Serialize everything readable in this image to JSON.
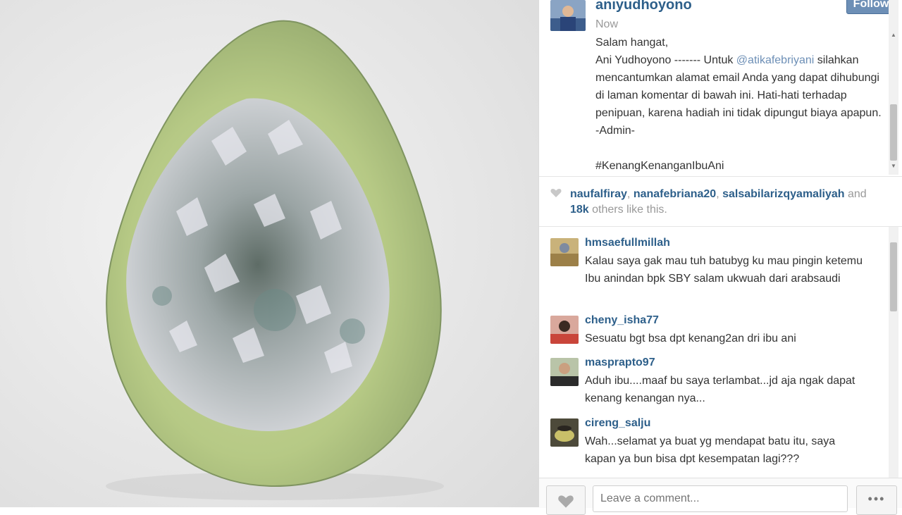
{
  "post": {
    "username": "aniyudhoyono",
    "follow_label": "Follow",
    "time": "Now",
    "caption_pre": "Salam hangat,\nAni Yudhoyono ------- Untuk ",
    "caption_mention": "@atikafebriyani",
    "caption_post": " silahkan mencantumkan alamat email Anda yang dapat dihubungi di laman komentar di bawah ini. Hati-hati terhadap penipuan, karena hadiah ini tidak dipungut biaya apapun. -Admin-\n\n#KenangKenanganIbuAni"
  },
  "likes": {
    "user1": "naufalfiray",
    "sep1": ", ",
    "user2": "nanafebriana20",
    "sep2": ", ",
    "user3": "salsabilarizqyamaliyah",
    "and": " and ",
    "count": "18k",
    "suffix": " others like this."
  },
  "comments": [
    {
      "user": "hmsaefullmillah",
      "text": "Kalau saya gak mau tuh batubyg ku mau pingin ketemu Ibu anindan bpk SBY salam ukwuah dari arabsaudi"
    },
    {
      "user": "cheny_isha77",
      "text": "Sesuatu bgt bsa dpt kenang2an dri ibu ani"
    },
    {
      "user": "masprapto97",
      "text": "Aduh ibu....maaf bu saya terlambat...jd aja ngak dapat kenang kenangan nya..."
    },
    {
      "user": "cireng_salju",
      "text": "Wah...selamat ya buat yg mendapat batu itu, saya kapan ya bun bisa dpt kesempatan lagi???"
    }
  ],
  "footer": {
    "comment_placeholder": "Leave a comment...",
    "more_label": "•••",
    "like_icon": "heart-icon"
  },
  "colors": {
    "link": "#2d5f8a",
    "mention": "#6d8fb6",
    "follow_bg": "#6d8fb6"
  }
}
